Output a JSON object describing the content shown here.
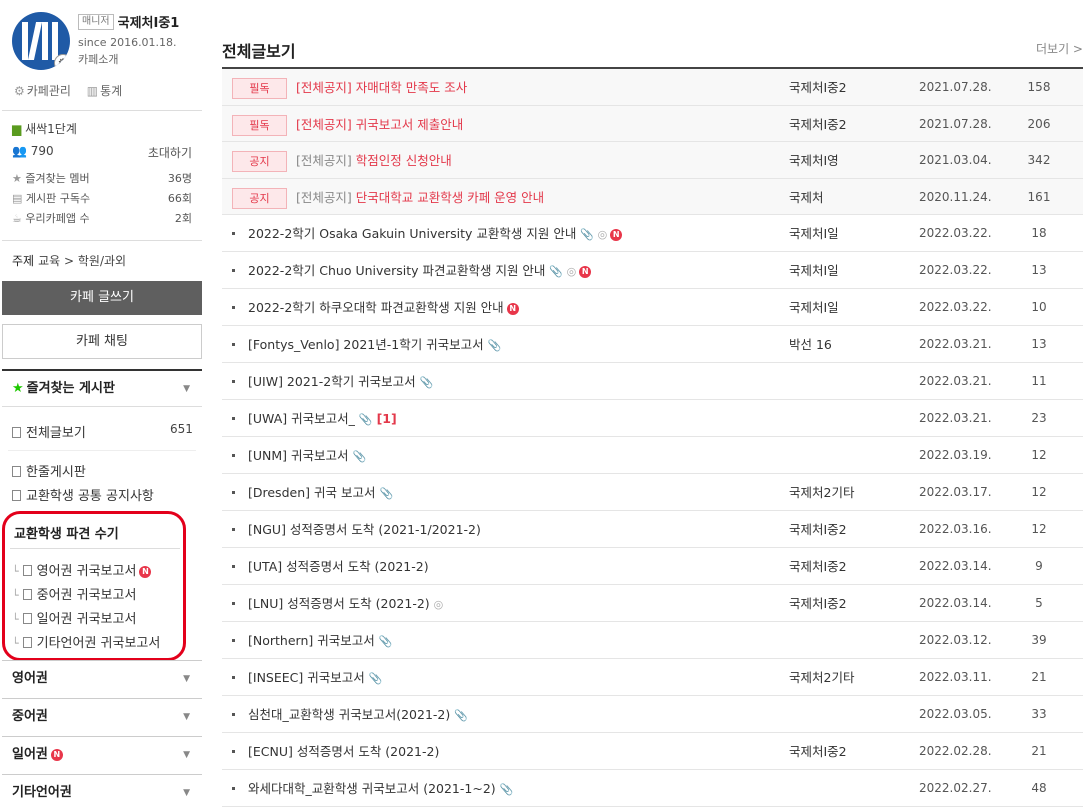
{
  "cafe": {
    "manager_badge": "매니저",
    "name": "국제처I중1",
    "since": "since 2016.01.18.",
    "intro": "카페소개",
    "admin_label": "카페관리",
    "stats_label": "통계"
  },
  "member": {
    "level": "새싹1단계",
    "count": "790",
    "invite": "초대하기",
    "fav_members_label": "즐겨찾는 멤버",
    "fav_members_count": "36명",
    "board_subs_label": "게시판 구독수",
    "board_subs_count": "66회",
    "app_label": "우리카페앱 수",
    "app_count": "2회"
  },
  "topic": {
    "label": "주제",
    "value": "교육 > 학원/과외"
  },
  "buttons": {
    "write": "카페 글쓰기",
    "chat": "카페 채팅"
  },
  "favorites": {
    "title": "즐겨찾는 게시판"
  },
  "menu": {
    "all_posts": "전체글보기",
    "all_posts_count": "651",
    "oneline": "한줄게시판",
    "common_notice": "교환학생 공통 공지사항"
  },
  "exchange_group": {
    "title": "교환학생 파견 수기",
    "items": [
      "영어권 귀국보고서",
      "중어권 귀국보고서",
      "일어권 귀국보고서",
      "기타언어권 귀국보고서"
    ],
    "new_badge": "N"
  },
  "categories": [
    "영어권",
    "중어권",
    "일어권",
    "기타언어권"
  ],
  "main": {
    "title": "전체글보기",
    "more": "더보기 >"
  },
  "notices": [
    {
      "tag": "필독",
      "prefix": "[전체공지]",
      "title": "자매대학 만족도 조사",
      "author": "국제처I중2",
      "date": "2021.07.28.",
      "views": "158"
    },
    {
      "tag": "필독",
      "prefix": "[전체공지]",
      "title": "귀국보고서 제출안내",
      "author": "국제처I중2",
      "date": "2021.07.28.",
      "views": "206"
    },
    {
      "tag": "공지",
      "prefix": "[전체공지]",
      "title": "학점인정 신청안내",
      "author": "국제처I영",
      "date": "2021.03.04.",
      "views": "342"
    },
    {
      "tag": "공지",
      "prefix": "[전체공지]",
      "title": "단국대학교 교환학생 카페 운영 안내",
      "author": "국제처",
      "date": "2020.11.24.",
      "views": "161"
    }
  ],
  "posts": [
    {
      "title": "2022-2학기 Osaka Gakuin University 교환학생 지원 안내",
      "icons": "📎 ◎",
      "new": "N",
      "comments": "",
      "author": "국제처I일",
      "date": "2022.03.22.",
      "views": "18"
    },
    {
      "title": "2022-2학기 Chuo University 파견교환학생 지원 안내",
      "icons": "📎 ◎",
      "new": "N",
      "comments": "",
      "author": "국제처I일",
      "date": "2022.03.22.",
      "views": "13"
    },
    {
      "title": "2022-2학기 하쿠오대학 파견교환학생 지원 안내",
      "icons": "",
      "new": "N",
      "comments": "",
      "author": "국제처I일",
      "date": "2022.03.22.",
      "views": "10"
    },
    {
      "title": "[Fontys_Venlo] 2021년-1학기 귀국보고서",
      "icons": "📎",
      "new": "",
      "comments": "",
      "author": "박선 16",
      "date": "2022.03.21.",
      "views": "13"
    },
    {
      "title": "[UIW] 2021-2학기 귀국보고서",
      "icons": "📎",
      "new": "",
      "comments": "",
      "author": "",
      "date": "2022.03.21.",
      "views": "11"
    },
    {
      "title": "[UWA] 귀국보고서_",
      "icons": "📎",
      "new": "",
      "comments": "[1]",
      "author": "",
      "date": "2022.03.21.",
      "views": "23"
    },
    {
      "title": "[UNM] 귀국보고서",
      "icons": "📎",
      "new": "",
      "comments": "",
      "author": "",
      "date": "2022.03.19.",
      "views": "12"
    },
    {
      "title": "[Dresden] 귀국 보고서",
      "icons": "📎",
      "new": "",
      "comments": "",
      "author": "국제처2기타",
      "date": "2022.03.17.",
      "views": "12"
    },
    {
      "title": "[NGU] 성적증명서 도착 (2021-1/2021-2)",
      "icons": "",
      "new": "",
      "comments": "",
      "author": "국제처I중2",
      "date": "2022.03.16.",
      "views": "12"
    },
    {
      "title": "[UTA] 성적증명서 도착 (2021-2)",
      "icons": "",
      "new": "",
      "comments": "",
      "author": "국제처I중2",
      "date": "2022.03.14.",
      "views": "9"
    },
    {
      "title": "[LNU] 성적증명서 도착 (2021-2)",
      "icons": "◎",
      "new": "",
      "comments": "",
      "author": "국제처I중2",
      "date": "2022.03.14.",
      "views": "5"
    },
    {
      "title": "[Northern] 귀국보고서",
      "icons": "📎",
      "new": "",
      "comments": "",
      "author": "",
      "date": "2022.03.12.",
      "views": "39"
    },
    {
      "title": "[INSEEC] 귀국보고서",
      "icons": "📎",
      "new": "",
      "comments": "",
      "author": "국제처2기타",
      "date": "2022.03.11.",
      "views": "21"
    },
    {
      "title": "심천대_교환학생 귀국보고서(2021-2)",
      "icons": "📎",
      "new": "",
      "comments": "",
      "author": "",
      "date": "2022.03.05.",
      "views": "33"
    },
    {
      "title": "[ECNU] 성적증명서 도착 (2021-2)",
      "icons": "",
      "new": "",
      "comments": "",
      "author": "국제처I중2",
      "date": "2022.02.28.",
      "views": "21"
    },
    {
      "title": "와세다대학_교환학생 귀국보고서 (2021-1~2)",
      "icons": "📎",
      "new": "",
      "comments": "",
      "author": "",
      "date": "2022.02.27.",
      "views": "48"
    }
  ]
}
